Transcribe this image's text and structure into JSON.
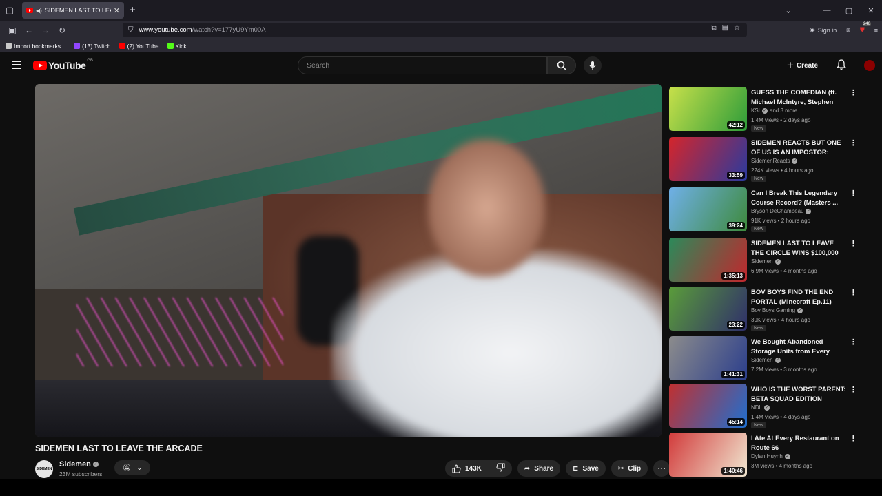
{
  "browser": {
    "tab_title": "SIDEMEN LAST TO LEAVE T",
    "url_host": "www.youtube.com",
    "url_path": "/watch?v=177yU9Ym00A",
    "signin_label": "Sign in",
    "ext_badge": "246",
    "bookmarks": [
      {
        "label": "Import bookmarks...",
        "icon": "import-icon",
        "color": "#c9c9c9"
      },
      {
        "label": "(13) Twitch",
        "icon": "twitch-icon",
        "color": "#9146ff"
      },
      {
        "label": "(2) YouTube",
        "icon": "youtube-icon",
        "color": "#ff0000"
      },
      {
        "label": "Kick",
        "icon": "kick-icon",
        "color": "#53fc18"
      }
    ]
  },
  "masthead": {
    "logo_text": "YouTube",
    "region": "GB",
    "search_placeholder": "Search",
    "create_label": "Create"
  },
  "video": {
    "title": "SIDEMEN LAST TO LEAVE THE ARCADE",
    "channel": "Sidemen",
    "channel_avatar_text": "SIDEMEN",
    "subscribers": "23M subscribers",
    "likes": "143K",
    "share_label": "Share",
    "save_label": "Save",
    "clip_label": "Clip"
  },
  "recommendations": [
    {
      "title": "GUESS THE COMEDIAN (ft. Michael McIntyre, Stephen Tri...",
      "channel": "KSI",
      "channel_extra": "and 3 more",
      "meta": "1.4M views • 2 days ago",
      "duration": "42:12",
      "is_new": true,
      "new_label": "New",
      "colors": [
        "#c7e04a",
        "#2e9c3a"
      ]
    },
    {
      "title": "SIDEMEN REACTS BUT ONE OF US IS AN IMPOSTOR: TIKTOK ...",
      "channel": "SidemenReacts",
      "channel_extra": "",
      "meta": "224K views • 4 hours ago",
      "duration": "33:59",
      "is_new": true,
      "new_label": "New",
      "colors": [
        "#d4252b",
        "#2a3a9e"
      ]
    },
    {
      "title": "Can I Break This Legendary Course Record? (Masters ...",
      "channel": "Bryson DeChambeau",
      "channel_extra": "",
      "meta": "91K views • 2 hours ago",
      "duration": "39:24",
      "is_new": true,
      "new_label": "New",
      "colors": [
        "#6fb0e8",
        "#3e8a3c"
      ]
    },
    {
      "title": "SIDEMEN LAST TO LEAVE THE CIRCLE WINS $100,000",
      "channel": "Sidemen",
      "channel_extra": "",
      "meta": "6.9M views • 4 months ago",
      "duration": "1:35:13",
      "is_new": false,
      "new_label": "",
      "colors": [
        "#2b8a5a",
        "#c1272d"
      ]
    },
    {
      "title": "BOV BOYS FIND THE END PORTAL (Minecraft Ep.11)",
      "channel": "Bov Boys Gaming",
      "channel_extra": "",
      "meta": "39K views • 4 hours ago",
      "duration": "23:22",
      "is_new": true,
      "new_label": "New",
      "colors": [
        "#5a9c3a",
        "#2f2f6a"
      ]
    },
    {
      "title": "We Bought Abandoned Storage Units from Every Continent an...",
      "channel": "Sidemen",
      "channel_extra": "",
      "meta": "7.2M views • 3 months ago",
      "duration": "1:41:31",
      "is_new": false,
      "new_label": "",
      "colors": [
        "#8c8c8c",
        "#2b3e8c"
      ]
    },
    {
      "title": "WHO IS THE WORST PARENT: BETA SQUAD EDITION",
      "channel": "NDL",
      "channel_extra": "",
      "meta": "1.4M views • 4 days ago",
      "duration": "45:14",
      "is_new": true,
      "new_label": "New",
      "colors": [
        "#c03030",
        "#1f6fd0"
      ]
    },
    {
      "title": "I Ate At Every Restaurant on Route 66",
      "channel": "Dylan Huynh",
      "channel_extra": "",
      "meta": "3M views • 4 months ago",
      "duration": "1:40:46",
      "is_new": false,
      "new_label": "",
      "colors": [
        "#d23c3c",
        "#f0e6d0"
      ]
    }
  ]
}
